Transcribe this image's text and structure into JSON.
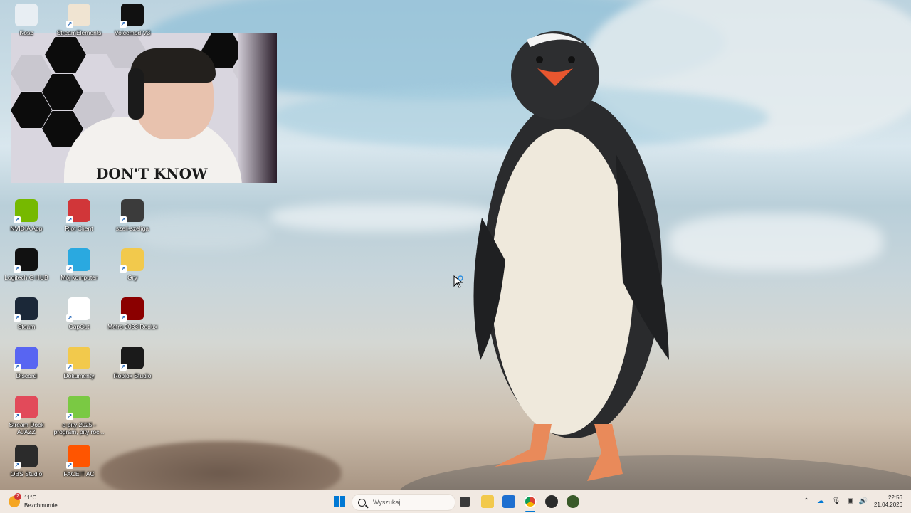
{
  "desktop_icons": [
    {
      "label": "Kosz",
      "icon": "recycle-bin-icon",
      "color": "#e8eef3"
    },
    {
      "label": "StreamElements",
      "icon": "streamelements-icon",
      "color": "#f0e4d2"
    },
    {
      "label": "Voicemod V3",
      "icon": "voicemod-icon",
      "color": "#111111"
    },
    {
      "label": "NVIDIA App",
      "icon": "nvidia-icon",
      "color": "#76b900"
    },
    {
      "label": "Riot Client",
      "icon": "riot-client-icon",
      "color": "#d13639"
    },
    {
      "label": "szeli-szeliga",
      "icon": "user-photo-icon",
      "color": "#3b3b3b"
    },
    {
      "label": "Logitech G HUB",
      "icon": "logitech-g-icon",
      "color": "#111111"
    },
    {
      "label": "Mój komputer",
      "icon": "computer-icon",
      "color": "#2aa9e0"
    },
    {
      "label": "Gry",
      "icon": "folder-icon",
      "color": "#f2c94c"
    },
    {
      "label": "Steam",
      "icon": "steam-icon",
      "color": "#1b2838"
    },
    {
      "label": "CapCut",
      "icon": "capcut-icon",
      "color": "#ffffff"
    },
    {
      "label": "Metro 2033 Redux",
      "icon": "metro-icon",
      "color": "#8b0000"
    },
    {
      "label": "Discord",
      "icon": "discord-icon",
      "color": "#5865f2"
    },
    {
      "label": "Dokumenty",
      "icon": "documents-folder-icon",
      "color": "#f2c94c"
    },
    {
      "label": "Roblox Studio",
      "icon": "roblox-studio-icon",
      "color": "#1a1a1a"
    },
    {
      "label": "Stream Dock AJAZZ",
      "icon": "stream-dock-icon",
      "color": "#e24a5a"
    },
    {
      "label": "e-pity 2025 - program, pity roc...",
      "icon": "epity-icon",
      "color": "#7ac943"
    },
    {
      "label": "OBS Studio",
      "icon": "obs-icon",
      "color": "#2b2b2b"
    },
    {
      "label": "FACEIT AC",
      "icon": "faceit-icon",
      "color": "#ff5500"
    }
  ],
  "webcam": {
    "shirt_text": "DON'T KNOW"
  },
  "taskbar": {
    "weather_temp": "11°C",
    "weather_desc": "Bezchmurnie",
    "weather_badge": "2",
    "search_placeholder": "Wyszukaj",
    "time": "22:56",
    "date": "21.04.2026",
    "accent": "#0078d4"
  }
}
